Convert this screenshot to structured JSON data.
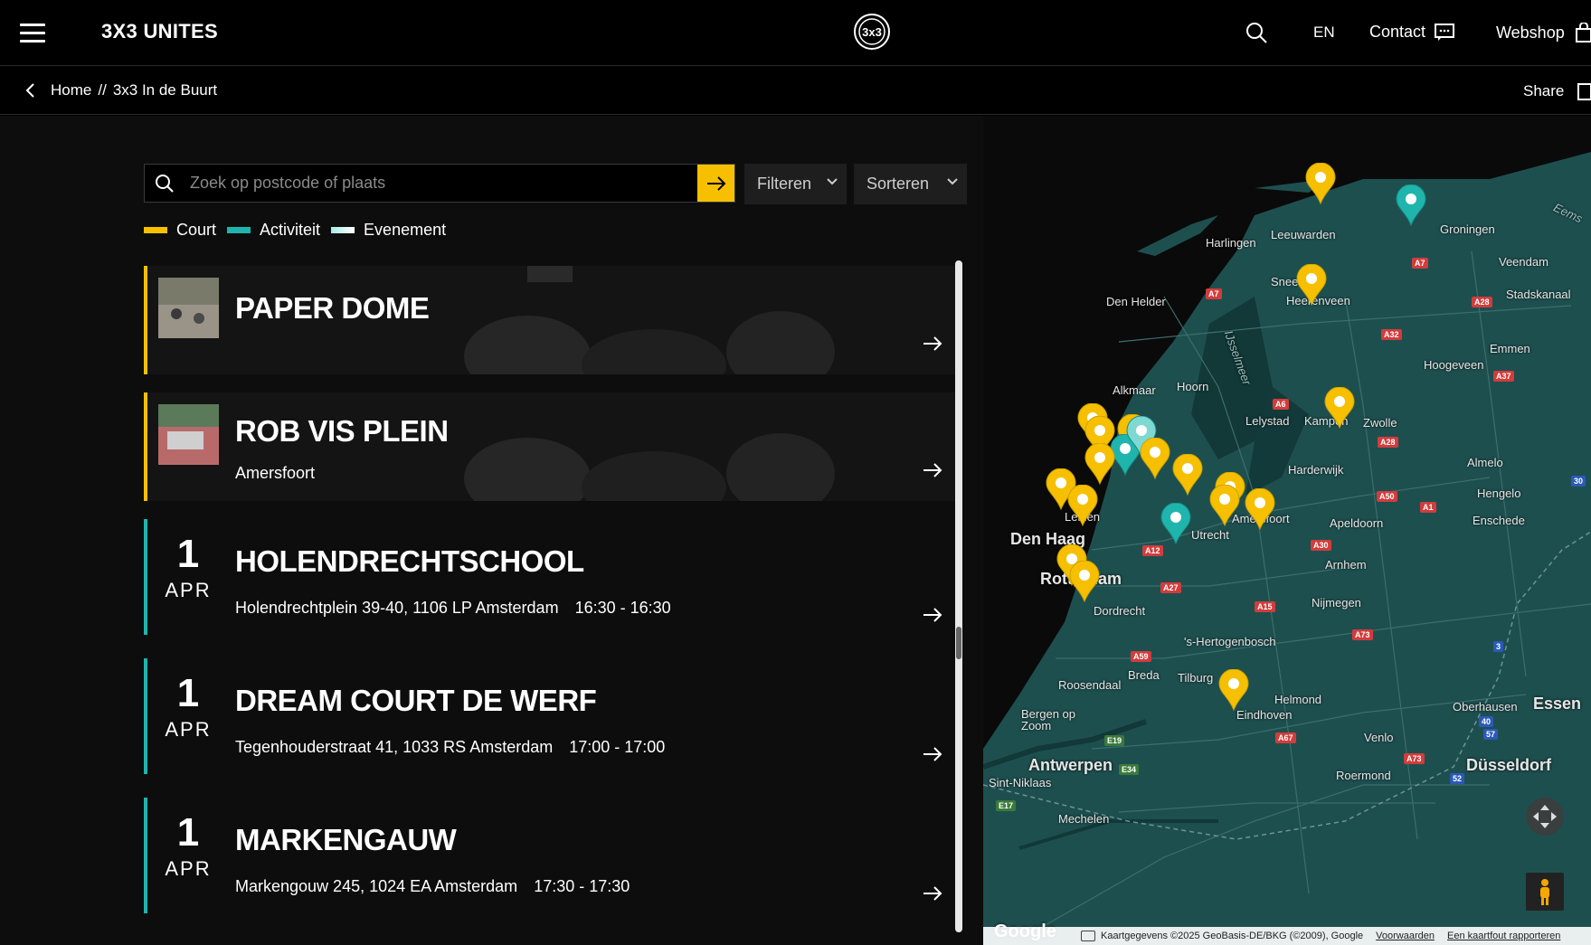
{
  "header": {
    "brand": "3X3 UNITES",
    "lang": "EN",
    "contact": "Contact",
    "webshop": "Webshop"
  },
  "breadcrumb": {
    "home": "Home",
    "separator": "//",
    "current": "3x3 In de Buurt",
    "share": "Share"
  },
  "search": {
    "placeholder": "Zoek op postcode of plaats",
    "filter_label": "Filteren",
    "sort_label": "Sorteren"
  },
  "legend": [
    {
      "label": "Court",
      "color": "#f6c000"
    },
    {
      "label": "Activiteit",
      "color": "#1fb5ad"
    },
    {
      "label": "Evenement",
      "color": "#a8ece8"
    }
  ],
  "courts": [
    {
      "title": "PAPER DOME",
      "subtitle": ""
    },
    {
      "title": "ROB VIS PLEIN",
      "subtitle": "Amersfoort"
    }
  ],
  "events": [
    {
      "day": "1",
      "month": "APR",
      "title": "HOLENDRECHTSCHOOL",
      "address": "Holendrechtplein 39-40, 1106 LP Amsterdam",
      "time": "16:30 - 16:30"
    },
    {
      "day": "1",
      "month": "APR",
      "title": "DREAM COURT DE WERF",
      "address": "Tegenhouderstraat 41, 1033 RS Amsterdam",
      "time": "17:00 - 17:00"
    },
    {
      "day": "1",
      "month": "APR",
      "title": "MARKENGAUW",
      "address": "Markengouw 245, 1024 EA Amsterdam",
      "time": "17:30 - 17:30"
    }
  ],
  "map": {
    "places": [
      "Leeuwarden",
      "Harlingen",
      "Sneek",
      "Heerenveen",
      "Den Helder",
      "Alkmaar",
      "Hoorn",
      "Lelystad",
      "Kampen",
      "Zwolle",
      "Harderwijk",
      "Apeldoorn",
      "Den Haag",
      "Rotterdam",
      "Dordrecht",
      "Arnhem",
      "Nijmegen",
      "'s-Hertogenbosch",
      "Breda",
      "Tilburg",
      "Roosendaal",
      "Bergen op Zoom",
      "Eindhoven",
      "Helmond",
      "Venlo",
      "Roermond",
      "Antwerpen",
      "Sint-Niklaas",
      "Mechelen",
      "Düsseldorf",
      "Oberhausen",
      "Essen",
      "Enschede",
      "Hengelo",
      "Almelo",
      "Emmen",
      "Hoogeveen",
      "Veendam",
      "Stadskanaal",
      "Groningen",
      "Leiden",
      "Amersfoort",
      "Utrecht",
      "IJsselmeer",
      "Eems"
    ],
    "roads": [
      "A7",
      "A7",
      "A28",
      "A32",
      "A6",
      "A28",
      "A37",
      "A50",
      "A1",
      "A12",
      "A30",
      "A27",
      "A15",
      "A73",
      "A59",
      "A67",
      "A73",
      "E19",
      "E34",
      "E17",
      "30",
      "3",
      "40",
      "57",
      "52"
    ],
    "attribution": "Kaartgegevens ©2025 GeoBasis-DE/BKG (©2009), Google",
    "terms": "Voorwaarden",
    "report": "Een kaartfout rapporteren",
    "google": "Google"
  }
}
